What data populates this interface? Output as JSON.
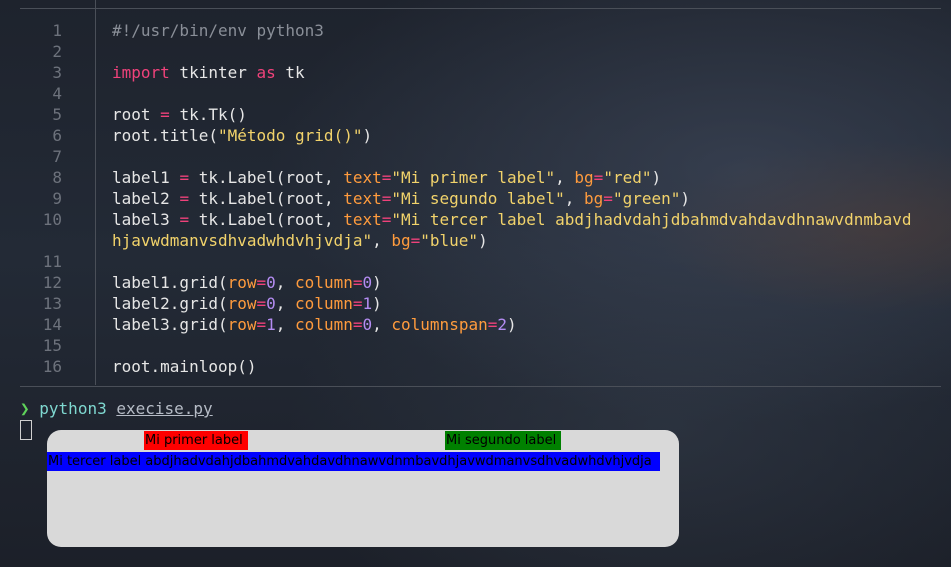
{
  "editor": {
    "lines": [
      {
        "n": "1",
        "tokens": [
          {
            "t": "#!/usr/bin/env python3",
            "c": "cm"
          }
        ]
      },
      {
        "n": "2",
        "tokens": []
      },
      {
        "n": "3",
        "tokens": [
          {
            "t": "import",
            "c": "kw"
          },
          {
            "t": " tkinter ",
            "c": ""
          },
          {
            "t": "as",
            "c": "kw"
          },
          {
            "t": " tk",
            "c": ""
          }
        ]
      },
      {
        "n": "4",
        "tokens": []
      },
      {
        "n": "5",
        "tokens": [
          {
            "t": "root ",
            "c": ""
          },
          {
            "t": "=",
            "c": "op"
          },
          {
            "t": " tk.Tk()",
            "c": ""
          }
        ]
      },
      {
        "n": "6",
        "tokens": [
          {
            "t": "root.title(",
            "c": ""
          },
          {
            "t": "\"Método grid()\"",
            "c": "str"
          },
          {
            "t": ")",
            "c": ""
          }
        ]
      },
      {
        "n": "7",
        "tokens": []
      },
      {
        "n": "8",
        "tokens": [
          {
            "t": "label1 ",
            "c": ""
          },
          {
            "t": "=",
            "c": "op"
          },
          {
            "t": " tk.Label(root, ",
            "c": ""
          },
          {
            "t": "text",
            "c": "kwa"
          },
          {
            "t": "=",
            "c": "op"
          },
          {
            "t": "\"Mi primer label\"",
            "c": "str"
          },
          {
            "t": ", ",
            "c": ""
          },
          {
            "t": "bg",
            "c": "kwa"
          },
          {
            "t": "=",
            "c": "op"
          },
          {
            "t": "\"red\"",
            "c": "str"
          },
          {
            "t": ")",
            "c": ""
          }
        ]
      },
      {
        "n": "9",
        "tokens": [
          {
            "t": "label2 ",
            "c": ""
          },
          {
            "t": "=",
            "c": "op"
          },
          {
            "t": " tk.Label(root, ",
            "c": ""
          },
          {
            "t": "text",
            "c": "kwa"
          },
          {
            "t": "=",
            "c": "op"
          },
          {
            "t": "\"Mi segundo label\"",
            "c": "str"
          },
          {
            "t": ", ",
            "c": ""
          },
          {
            "t": "bg",
            "c": "kwa"
          },
          {
            "t": "=",
            "c": "op"
          },
          {
            "t": "\"green\"",
            "c": "str"
          },
          {
            "t": ")",
            "c": ""
          }
        ]
      },
      {
        "n": "10",
        "tokens": [
          {
            "t": "label3 ",
            "c": ""
          },
          {
            "t": "=",
            "c": "op"
          },
          {
            "t": " tk.Label(root, ",
            "c": ""
          },
          {
            "t": "text",
            "c": "kwa"
          },
          {
            "t": "=",
            "c": "op"
          },
          {
            "t": "\"Mi tercer label abdjhadvdahjdbahmdvahdavdhnawvdnmbavd",
            "c": "str"
          }
        ]
      },
      {
        "n": "",
        "tokens": [
          {
            "t": "hjavwdmanvsdhvadwhdvhjvdja\"",
            "c": "str"
          },
          {
            "t": ", ",
            "c": ""
          },
          {
            "t": "bg",
            "c": "kwa"
          },
          {
            "t": "=",
            "c": "op"
          },
          {
            "t": "\"blue\"",
            "c": "str"
          },
          {
            "t": ")",
            "c": ""
          }
        ]
      },
      {
        "n": "11",
        "tokens": []
      },
      {
        "n": "12",
        "tokens": [
          {
            "t": "label1.grid(",
            "c": ""
          },
          {
            "t": "row",
            "c": "kwa"
          },
          {
            "t": "=",
            "c": "op"
          },
          {
            "t": "0",
            "c": "num"
          },
          {
            "t": ", ",
            "c": ""
          },
          {
            "t": "column",
            "c": "kwa"
          },
          {
            "t": "=",
            "c": "op"
          },
          {
            "t": "0",
            "c": "num"
          },
          {
            "t": ")",
            "c": ""
          }
        ]
      },
      {
        "n": "13",
        "tokens": [
          {
            "t": "label2.grid(",
            "c": ""
          },
          {
            "t": "row",
            "c": "kwa"
          },
          {
            "t": "=",
            "c": "op"
          },
          {
            "t": "0",
            "c": "num"
          },
          {
            "t": ", ",
            "c": ""
          },
          {
            "t": "column",
            "c": "kwa"
          },
          {
            "t": "=",
            "c": "op"
          },
          {
            "t": "1",
            "c": "num"
          },
          {
            "t": ")",
            "c": ""
          }
        ]
      },
      {
        "n": "14",
        "tokens": [
          {
            "t": "label3.grid(",
            "c": ""
          },
          {
            "t": "row",
            "c": "kwa"
          },
          {
            "t": "=",
            "c": "op"
          },
          {
            "t": "1",
            "c": "num"
          },
          {
            "t": ", ",
            "c": ""
          },
          {
            "t": "column",
            "c": "kwa"
          },
          {
            "t": "=",
            "c": "op"
          },
          {
            "t": "0",
            "c": "num"
          },
          {
            "t": ", ",
            "c": ""
          },
          {
            "t": "columnspan",
            "c": "kwa"
          },
          {
            "t": "=",
            "c": "op"
          },
          {
            "t": "2",
            "c": "num"
          },
          {
            "t": ")",
            "c": ""
          }
        ]
      },
      {
        "n": "15",
        "tokens": []
      },
      {
        "n": "16",
        "tokens": [
          {
            "t": "root.mainloop()",
            "c": ""
          }
        ]
      }
    ]
  },
  "terminal": {
    "prompt_symbol": "❯",
    "command": "python3",
    "file": "execise.py"
  },
  "tk_window": {
    "label1": "Mi primer label",
    "label2": "Mi segundo label",
    "label3": "Mi tercer label abdjhadvdahjdbahmdvahdavdhnawvdnmbavdhjavwdmanvsdhvadwhdvhjvdja"
  },
  "colors": {
    "red": "#ff0000",
    "green": "#008000",
    "blue": "#0000ff"
  }
}
